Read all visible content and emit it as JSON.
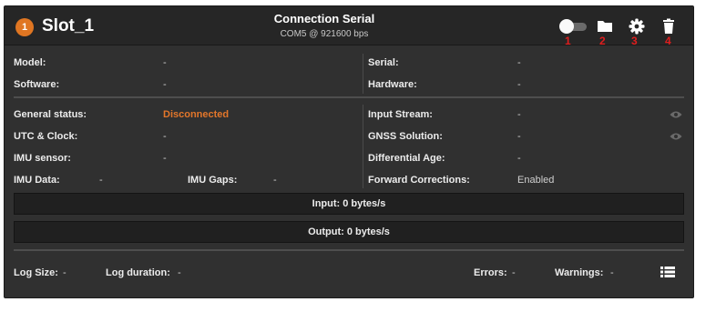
{
  "header": {
    "slot_number": "1",
    "slot_name": "Slot_1",
    "connection_title": "Connection Serial",
    "connection_sub": "COM5 @ 921600 bps",
    "tool_numbers": [
      "1",
      "2",
      "3",
      "4"
    ]
  },
  "info": {
    "model_label": "Model:",
    "model_value": "-",
    "software_label": "Software:",
    "software_value": "-",
    "serial_label": "Serial:",
    "serial_value": "-",
    "hardware_label": "Hardware:",
    "hardware_value": "-"
  },
  "status": {
    "general_label": "General status:",
    "general_value": "Disconnected",
    "utc_label": "UTC & Clock:",
    "utc_value": "-",
    "imu_sensor_label": "IMU sensor:",
    "imu_sensor_value": "-",
    "imu_data_label": "IMU Data:",
    "imu_data_value": "-",
    "imu_gaps_label": "IMU Gaps:",
    "imu_gaps_value": "-",
    "input_stream_label": "Input Stream:",
    "input_stream_value": "-",
    "gnss_label": "GNSS Solution:",
    "gnss_value": "-",
    "diff_age_label": "Differential Age:",
    "diff_age_value": "-",
    "fwd_corr_label": "Forward Corrections:",
    "fwd_corr_value": "Enabled"
  },
  "io": {
    "input": "Input: 0 bytes/s",
    "output": "Output: 0 bytes/s"
  },
  "footer": {
    "log_size_label": "Log Size:",
    "log_size_value": "-",
    "log_duration_label": "Log duration:",
    "log_duration_value": "-",
    "errors_label": "Errors:",
    "errors_value": "-",
    "warnings_label": "Warnings:",
    "warnings_value": "-"
  },
  "colors": {
    "accent": "#e07622",
    "annotation": "#e01e1e",
    "panel": "#303030"
  },
  "icons": [
    "toggle-icon",
    "folder-icon",
    "gear-icon",
    "trash-icon",
    "eye-icon",
    "list-icon"
  ]
}
